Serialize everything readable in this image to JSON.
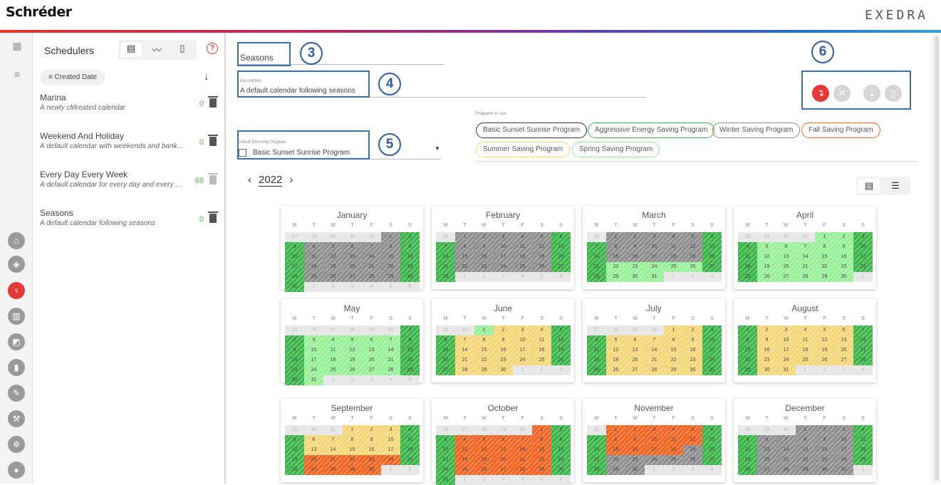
{
  "header": {
    "brand": "Schréder",
    "product": "EXEDRA"
  },
  "sidebar": {
    "title": "Schedulers",
    "sort_label": "Created Date",
    "items": [
      {
        "name": "Marina",
        "description": "A newly cMreated calendar",
        "count": "0"
      },
      {
        "name": "Weekend And Holiday",
        "description": "A default calendar with weekends and bank holidays",
        "count": "0"
      },
      {
        "name": "Every Day Every Week",
        "description": "A default calendar for every day and every week",
        "count": "68"
      },
      {
        "name": "Seasons",
        "description": "A default calendar following seasons",
        "count": "0"
      }
    ]
  },
  "form": {
    "name_value": "Seasons",
    "description_label": "Description",
    "description_value": "A default calendar following seasons",
    "dimming_label": "Default Dimming Program",
    "dimming_value": "Basic Sunset Sunrise Program",
    "programs_label": "Programs in use",
    "programs": [
      {
        "label": "Basic Sunset Sunrise Program",
        "color": "#333333"
      },
      {
        "label": "Aggressive Energy Saving Program",
        "color": "#3fb24a"
      },
      {
        "label": "Winter Saving Program",
        "color": "#8c8c8c"
      },
      {
        "label": "Fall Saving Program",
        "color": "#f26522"
      },
      {
        "label": "Summer Saving Program",
        "color": "#f5d76e"
      },
      {
        "label": "Spring Saving Program",
        "color": "#90ee90"
      }
    ]
  },
  "callouts": [
    "3",
    "4",
    "5",
    "6"
  ],
  "calendar": {
    "year": "2022",
    "dow": [
      "M",
      "T",
      "W",
      "T",
      "F",
      "S",
      "S"
    ],
    "colors": {
      "green": "#3cb64a",
      "gray": "#8f8f8f",
      "lightgreen": "#98f098",
      "yellow": "#f5d77a",
      "orange": "#f26522",
      "outside": "#e8e8e8"
    },
    "months": [
      {
        "name": "January",
        "offset": 5,
        "days": 31
      },
      {
        "name": "February",
        "offset": 1,
        "days": 28
      },
      {
        "name": "March",
        "offset": 1,
        "days": 31
      },
      {
        "name": "April",
        "offset": 4,
        "days": 30
      },
      {
        "name": "May",
        "offset": 6,
        "days": 31
      },
      {
        "name": "June",
        "offset": 2,
        "days": 30
      },
      {
        "name": "July",
        "offset": 4,
        "days": 31
      },
      {
        "name": "August",
        "offset": 0,
        "days": 31
      },
      {
        "name": "September",
        "offset": 3,
        "days": 30
      },
      {
        "name": "October",
        "offset": 5,
        "days": 31
      },
      {
        "name": "November",
        "offset": 1,
        "days": 30
      },
      {
        "name": "December",
        "offset": 3,
        "days": 31
      }
    ]
  },
  "rail_icons": [
    "home-icon",
    "badge-icon",
    "bulb-icon",
    "cabinet-icon",
    "chart-icon",
    "device-icon",
    "wrench-icon",
    "tools-icon",
    "network-icon",
    "user-icon"
  ]
}
